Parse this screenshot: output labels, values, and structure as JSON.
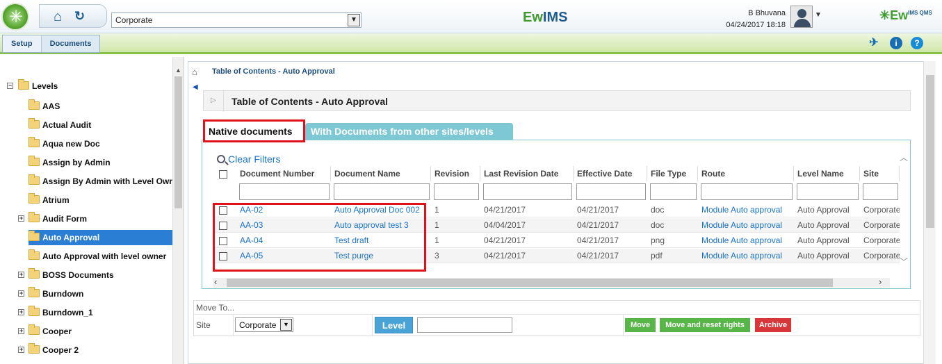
{
  "header": {
    "site_value": "Corporate",
    "center_logo_prefix": "Ew",
    "center_logo_suffix": "IMS",
    "user_name": "B Bhuvana",
    "datetime": "04/24/2017 18:18",
    "right_logo": "Ew",
    "right_logo_sup": "IMS QMS"
  },
  "nav": {
    "tabs": [
      {
        "label": "Setup"
      },
      {
        "label": "Documents"
      }
    ]
  },
  "sidebar": {
    "root": "Levels",
    "items": [
      {
        "label": "AAS",
        "expandable": false,
        "selected": false
      },
      {
        "label": "Actual Audit",
        "expandable": false,
        "selected": false
      },
      {
        "label": "Aqua new Doc",
        "expandable": false,
        "selected": false
      },
      {
        "label": "Assign by Admin",
        "expandable": false,
        "selected": false
      },
      {
        "label": "Assign By Admin with Level Owr",
        "expandable": false,
        "selected": false
      },
      {
        "label": "Atrium",
        "expandable": false,
        "selected": false
      },
      {
        "label": "Audit Form",
        "expandable": true,
        "selected": false
      },
      {
        "label": "Auto Approval",
        "expandable": false,
        "selected": true
      },
      {
        "label": "Auto Approval with level owner",
        "expandable": false,
        "selected": false
      },
      {
        "label": "BOSS Documents",
        "expandable": true,
        "selected": false
      },
      {
        "label": "Burndown",
        "expandable": true,
        "selected": false
      },
      {
        "label": "Burndown_1",
        "expandable": true,
        "selected": false
      },
      {
        "label": "Cooper",
        "expandable": true,
        "selected": false
      },
      {
        "label": "Cooper 2",
        "expandable": true,
        "selected": false
      }
    ]
  },
  "main": {
    "breadcrumb": "Table of Contents - Auto Approval",
    "panel_title": "Table of Contents - Auto Approval",
    "tabs": [
      {
        "label": "Native documents",
        "active": true
      },
      {
        "label": "With Documents from other sites/levels",
        "active": false
      }
    ],
    "clear_filters": "Clear Filters",
    "columns": [
      "Document Number",
      "Document Name",
      "Revision",
      "Last Revision Date",
      "Effective Date",
      "File Type",
      "Route",
      "Level Name",
      "Site"
    ],
    "rows": [
      [
        "AA-02",
        "Auto Approval Doc 002",
        "1",
        "04/21/2017",
        "04/21/2017",
        "doc",
        "Module Auto approval",
        "Auto Approval",
        "Corporate"
      ],
      [
        "AA-03",
        "Auto approval test 3",
        "1",
        "04/04/2017",
        "04/21/2017",
        "doc",
        "Module Auto approval",
        "Auto Approval",
        "Corporate"
      ],
      [
        "AA-04",
        "Test draft",
        "1",
        "04/21/2017",
        "04/21/2017",
        "png",
        "Module Auto approval",
        "Auto Approval",
        "Corporate"
      ],
      [
        "AA-05",
        "Test purge",
        "3",
        "04/21/2017",
        "04/21/2017",
        "pdf",
        "Module Auto approval",
        "Auto Approval",
        "Corporate"
      ]
    ]
  },
  "move": {
    "title": "Move To...",
    "site_label": "Site",
    "site_value": "Corporate",
    "level_button": "Level",
    "level_value": "",
    "move_button": "Move",
    "move_reset_button": "Move and reset rights",
    "archive_button": "Archive"
  },
  "colors": {
    "accent_blue": "#1a73c9",
    "tab_teal": "#7ec8d6",
    "highlight_red": "#e0111b",
    "green_button": "#58b548",
    "archive_red": "#d9363a",
    "selected_blue": "#2a7fd4"
  }
}
